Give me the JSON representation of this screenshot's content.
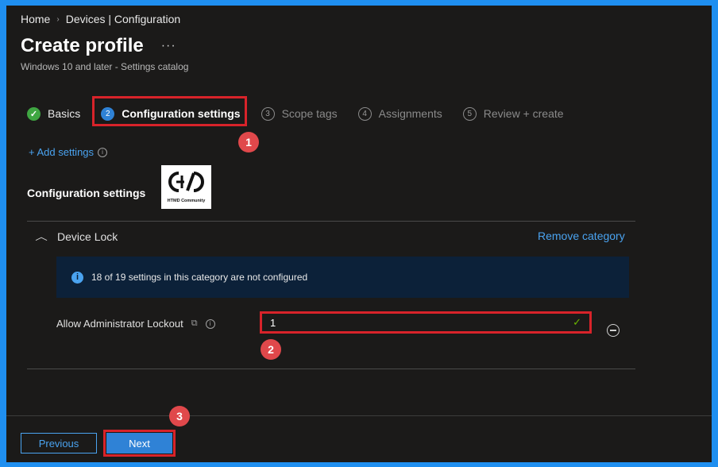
{
  "breadcrumb": {
    "home": "Home",
    "separator": "›",
    "current": "Devices | Configuration"
  },
  "header": {
    "title": "Create profile",
    "more": "···",
    "subtitle": "Windows 10 and later - Settings catalog"
  },
  "steps": [
    {
      "label": "Basics",
      "state": "done",
      "marker": "✓"
    },
    {
      "label": "Configuration settings",
      "state": "active",
      "marker": "2"
    },
    {
      "label": "Scope tags",
      "state": "pending",
      "marker": "3"
    },
    {
      "label": "Assignments",
      "state": "pending",
      "marker": "4"
    },
    {
      "label": "Review + create",
      "state": "pending",
      "marker": "5"
    }
  ],
  "annotations": {
    "badge1": "1",
    "badge2": "2",
    "badge3": "3"
  },
  "add_settings": {
    "label": "+ Add settings",
    "info": "i"
  },
  "section": {
    "title": "Configuration settings"
  },
  "logo": {
    "caption": "HTMD Community"
  },
  "category": {
    "name": "Device Lock",
    "remove_label": "Remove category",
    "info_icon": "i",
    "info_text": "18 of 19 settings in this category are not configured"
  },
  "setting": {
    "label": "Allow Administrator Lockout",
    "sync_icon": "⧉",
    "info": "i",
    "value": "1",
    "check": "✓"
  },
  "footer": {
    "previous_label": "Previous",
    "next_label": "Next"
  },
  "colors": {
    "accent": "#4aa3f0",
    "highlight": "#d8232a",
    "badge": "#e0484b",
    "success": "#3fa642",
    "background": "#1b1a19",
    "border": "#1f8ff0"
  }
}
